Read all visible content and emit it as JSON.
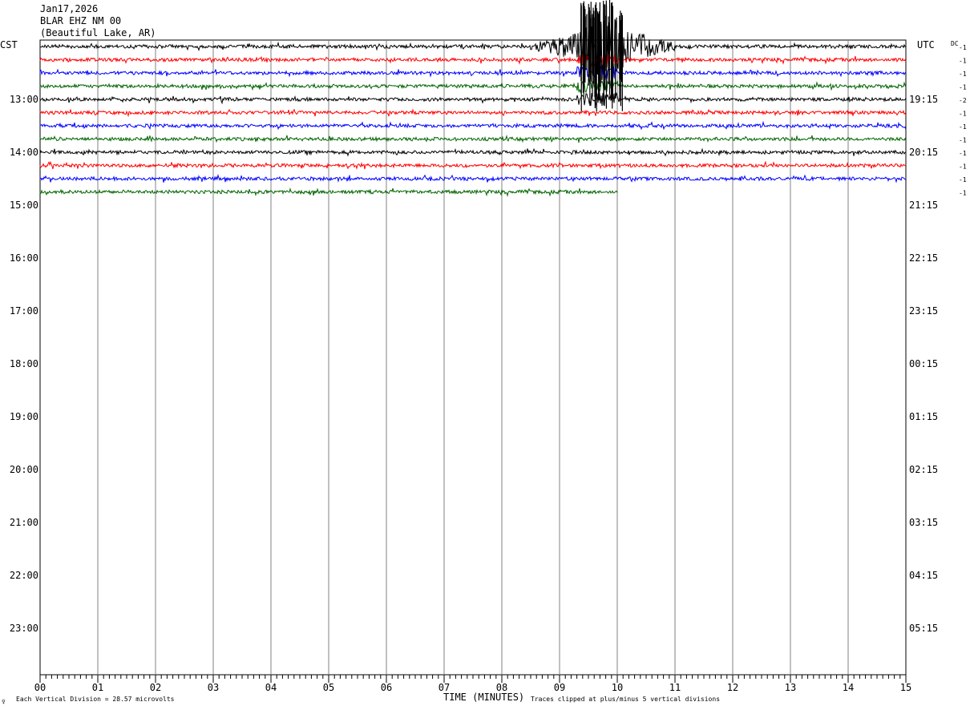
{
  "header": {
    "date": "Jan17,2026",
    "station": "BLAR EHZ NM 00",
    "location": "(Beautiful Lake, AR)"
  },
  "left_axis_label": "CST",
  "right_axis_label": "UTC",
  "dc_label": "DC",
  "footer": {
    "xlabel": "TIME (MINUTES)",
    "division_note": "Each Vertical Division =   28.57 microvolts",
    "clip_note": "Traces clipped at plus/minus 5 vertical divisions",
    "corner_mark": "♀"
  },
  "chart_data": {
    "type": "line",
    "title": "",
    "xlabel": "TIME (MINUTES)",
    "xlim": [
      0,
      15
    ],
    "x_ticks": [
      "00",
      "01",
      "02",
      "03",
      "04",
      "05",
      "06",
      "07",
      "08",
      "09",
      "10",
      "11",
      "12",
      "13",
      "14",
      "15"
    ],
    "cst_hour_labels": [
      "13:00",
      "14:00",
      "15:00",
      "16:00",
      "17:00",
      "18:00",
      "19:00",
      "20:00",
      "21:00",
      "22:00",
      "23:00"
    ],
    "utc_hour_labels": [
      "19:15",
      "20:15",
      "21:15",
      "22:15",
      "23:15",
      "00:15",
      "01:15",
      "02:15",
      "03:15",
      "04:15",
      "05:15"
    ],
    "trace_colors": [
      "#000000",
      "#ff0000",
      "#0000ff",
      "#006400"
    ],
    "traces": [
      {
        "row": 0,
        "dc": "-1",
        "end_minute": 15
      },
      {
        "row": 1,
        "dc": "-1",
        "end_minute": 15
      },
      {
        "row": 2,
        "dc": "-1",
        "end_minute": 15
      },
      {
        "row": 3,
        "dc": "-1",
        "end_minute": 15
      },
      {
        "row": 4,
        "dc": "-2",
        "end_minute": 15
      },
      {
        "row": 5,
        "dc": "-1",
        "end_minute": 15
      },
      {
        "row": 6,
        "dc": "-1",
        "end_minute": 15
      },
      {
        "row": 7,
        "dc": "-1",
        "end_minute": 15
      },
      {
        "row": 8,
        "dc": "-1",
        "end_minute": 15
      },
      {
        "row": 9,
        "dc": "-1",
        "end_minute": 15
      },
      {
        "row": 10,
        "dc": "-1",
        "end_minute": 15
      },
      {
        "row": 11,
        "dc": "-1",
        "end_minute": 10
      }
    ],
    "event": {
      "start_minute": 8.5,
      "end_minute": 11.0,
      "peak_minute": 9.8
    }
  }
}
